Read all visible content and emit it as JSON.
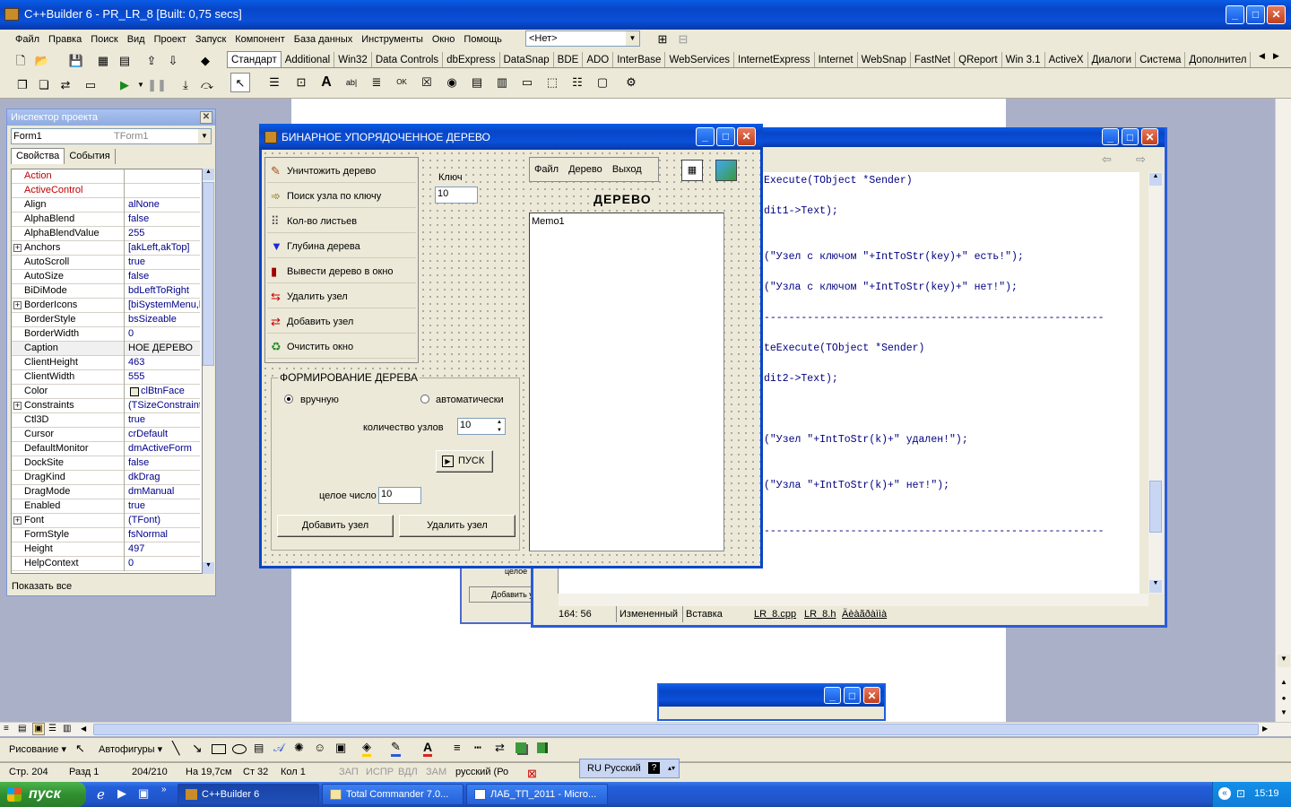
{
  "main_window": {
    "title": "C++Builder 6 - PR_LR_8 [Built: 0,75 secs]",
    "menu": [
      "Файл",
      "Правка",
      "Поиск",
      "Вид",
      "Проект",
      "Запуск",
      "Компонент",
      "База данных",
      "Инструменты",
      "Окно",
      "Помощь"
    ],
    "config_combo": "<Нет>",
    "palette_tabs": [
      "Стандарт",
      "Additional",
      "Win32",
      "Data Controls",
      "dbExpress",
      "DataSnap",
      "BDE",
      "ADO",
      "InterBase",
      "WebServices",
      "InternetExpress",
      "Internet",
      "WebSnap",
      "FastNet",
      "QReport",
      "Win 3.1",
      "ActiveX",
      "Диалоги",
      "Система",
      "Дополнител"
    ],
    "active_palette_tab": "Стандарт"
  },
  "inspector": {
    "title": "Инспектор проекта",
    "object_combo": "Form1",
    "object_type": "TForm1",
    "tabs": [
      "Свойства",
      "События"
    ],
    "properties": [
      {
        "k": "Action",
        "v": "",
        "red": true
      },
      {
        "k": "ActiveControl",
        "v": "",
        "red": true
      },
      {
        "k": "Align",
        "v": "alNone"
      },
      {
        "k": "AlphaBlend",
        "v": "false"
      },
      {
        "k": "AlphaBlendValue",
        "v": "255"
      },
      {
        "k": "Anchors",
        "v": "[akLeft,akTop]",
        "plus": true
      },
      {
        "k": "AutoScroll",
        "v": "true"
      },
      {
        "k": "AutoSize",
        "v": "false"
      },
      {
        "k": "BiDiMode",
        "v": "bdLeftToRight"
      },
      {
        "k": "BorderIcons",
        "v": "[biSystemMenu,b",
        "plus": true
      },
      {
        "k": "BorderStyle",
        "v": "bsSizeable"
      },
      {
        "k": "BorderWidth",
        "v": "0"
      },
      {
        "k": "Caption",
        "v": "НОЕ  ДЕРЕВО",
        "sel": true
      },
      {
        "k": "ClientHeight",
        "v": "463"
      },
      {
        "k": "ClientWidth",
        "v": "555"
      },
      {
        "k": "Color",
        "v": "clBtnFace",
        "swatch": true
      },
      {
        "k": "Constraints",
        "v": "(TSizeConstraint:",
        "plus": true
      },
      {
        "k": "Ctl3D",
        "v": "true"
      },
      {
        "k": "Cursor",
        "v": "crDefault"
      },
      {
        "k": "DefaultMonitor",
        "v": "dmActiveForm"
      },
      {
        "k": "DockSite",
        "v": "false"
      },
      {
        "k": "DragKind",
        "v": "dkDrag"
      },
      {
        "k": "DragMode",
        "v": "dmManual"
      },
      {
        "k": "Enabled",
        "v": "true"
      },
      {
        "k": "Font",
        "v": "(TFont)",
        "plus": true
      },
      {
        "k": "FormStyle",
        "v": "fsNormal"
      },
      {
        "k": "Height",
        "v": "497"
      },
      {
        "k": "HelpContext",
        "v": "0"
      }
    ],
    "footer": "Показать все"
  },
  "form": {
    "title": "БИНАРНОЕ  УПОРЯДОЧЕННОЕ  ДЕРЕВО",
    "tool_buttons": [
      "Уничтожить дерево",
      "Поиск узла по ключу",
      "Кол-во листьев",
      "Глубина дерева",
      "Вывести дерево в окно",
      "Удалить узел",
      "Добавить узел",
      "Очистить окно"
    ],
    "key_label": "Ключ",
    "key_value": "10",
    "menu": [
      "Файл",
      "Дерево",
      "Выход"
    ],
    "tree_label": "ДЕРЕВО",
    "memo_text": "Memo1",
    "group_title": "ФОРМИРОВАНИЕ ДЕРЕВА",
    "radio_manual": "вручную",
    "radio_auto": "автоматически",
    "count_label": "количество узлов",
    "count_value": "10",
    "start_button": "ПУСК",
    "int_label": "целое число",
    "int_value": "10",
    "add_button": "Добавить узел",
    "delete_button": "Удалить узел"
  },
  "editor": {
    "lines": [
      "Execute(TObject *Sender)",
      "dit1->Text);",
      "(\"Узел с ключом \"+IntToStr(key)+\" есть!\");",
      "(\"Узла с ключом \"+IntToStr(key)+\" нет!\");",
      "-------------------------------------------------------",
      "teExecute(TObject *Sender)",
      "dit2->Text);",
      "(\"Узел \"+IntToStr(k)+\" удален!\");",
      "(\"Узла \"+IntToStr(k)+\" нет!\");",
      "-------------------------------------------------------"
    ],
    "status_pos": "164:  56",
    "status_modified": "Измененный",
    "status_insert": "Вставка",
    "tabs": [
      "LR_8.cpp",
      "LR_8.h",
      "Äèàãðàììà"
    ]
  },
  "behind_form": {
    "label1": "целое",
    "button": "Добавить у"
  },
  "word": {
    "draw_label": "Рисование",
    "autoshapes_label": "Автофигуры",
    "status": [
      "Стр. 204",
      "Разд 1",
      "204/210",
      "На 19,7см",
      "Ст 32",
      "Кол 1",
      "ЗАП",
      "ИСПР",
      "ВДЛ",
      "ЗАМ",
      "русский (Ро"
    ]
  },
  "language_bar": {
    "lang": "RU Русский"
  },
  "taskbar": {
    "start": "пуск",
    "items": [
      "C++Builder 6",
      "Total Commander 7.0...",
      "ЛАБ_ТП_2011 - Micro..."
    ],
    "clock": "15:19"
  },
  "colors": {
    "accent": "#0a5ce6",
    "face": "#ece9d8",
    "taskbar": "#245edb",
    "start": "#3c9a3c"
  }
}
